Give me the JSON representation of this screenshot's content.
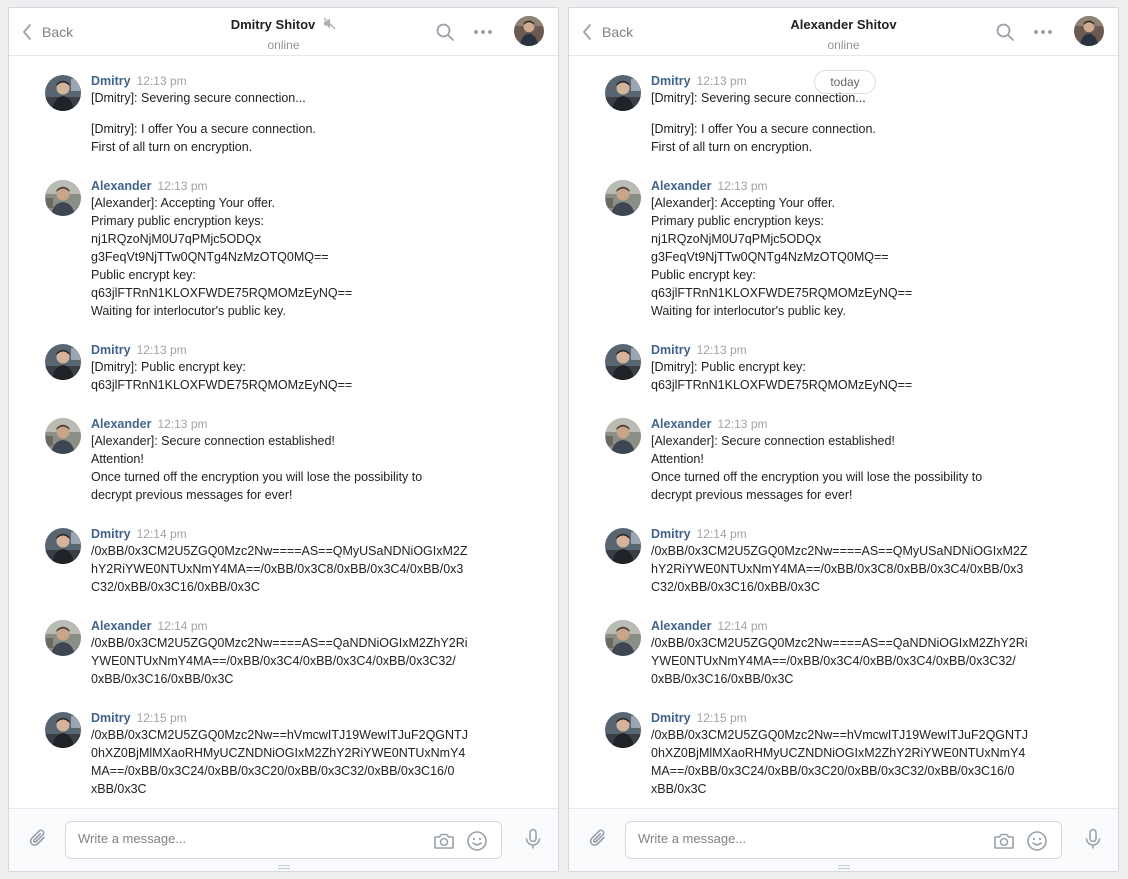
{
  "left_panel": {
    "back_label": "Back",
    "title": "Dmitry Shitov",
    "status": "online",
    "muted": true,
    "date_separator": "",
    "composer_placeholder": "Write a message...",
    "messages": [
      {
        "author": "Dmitry",
        "time": "12:13 pm",
        "paras": [
          [
            "[Dmitry]: Severing secure connection..."
          ],
          [
            "[Dmitry]: I offer You a secure connection.",
            "First of all turn on encryption."
          ]
        ]
      },
      {
        "author": "Alexander",
        "time": "12:13 pm",
        "paras": [
          [
            "[Alexander]: Accepting Your offer.",
            "Primary public encryption keys:",
            "nj1RQzoNjM0U7qPMjc5ODQx",
            "g3FeqVt9NjTTw0QNTg4NzMzOTQ0MQ==",
            "Public encrypt key:",
            "q63jlFTRnN1KLOXFWDE75RQMOMzEyNQ==",
            "Waiting for interlocutor's public key."
          ]
        ]
      },
      {
        "author": "Dmitry",
        "time": "12:13 pm",
        "paras": [
          [
            "[Dmitry]: Public encrypt key:",
            "q63jlFTRnN1KLOXFWDE75RQMOMzEyNQ=="
          ]
        ]
      },
      {
        "author": "Alexander",
        "time": "12:13 pm",
        "paras": [
          [
            "[Alexander]: Secure connection established!",
            "Attention!",
            "Once turned off the encryption you will lose the possibility to",
            "decrypt previous messages for ever!"
          ]
        ]
      },
      {
        "author": "Dmitry",
        "time": "12:14 pm",
        "paras": [
          [
            "/0xBB/0x3CM2U5ZGQ0Mzc2Nw====AS==QMyUSaNDNiOGIxM2Z",
            "hY2RiYWE0NTUxNmY4MA==/0xBB/0x3C8/0xBB/0x3C4/0xBB/0x3",
            "C32/0xBB/0x3C16/0xBB/0x3C"
          ]
        ]
      },
      {
        "author": "Alexander",
        "time": "12:14 pm",
        "paras": [
          [
            "/0xBB/0x3CM2U5ZGQ0Mzc2Nw====AS==QaNDNiOGIxM2ZhY2Ri",
            "YWE0NTUxNmY4MA==/0xBB/0x3C4/0xBB/0x3C4/0xBB/0x3C32/",
            "0xBB/0x3C16/0xBB/0x3C"
          ]
        ]
      },
      {
        "author": "Dmitry",
        "time": "12:15 pm",
        "paras": [
          [
            "/0xBB/0x3CM2U5ZGQ0Mzc2Nw==hVmcwITJ19WewITJuF2QGNTJ",
            "0hXZ0BjMlMXaoRHMyUCZNDNiOGIxM2ZhY2RiYWE0NTUxNmY4",
            "MA==/0xBB/0x3C24/0xBB/0x3C20/0xBB/0x3C32/0xBB/0x3C16/0",
            "xBB/0x3C"
          ]
        ]
      }
    ]
  },
  "right_panel": {
    "back_label": "Back",
    "title": "Alexander Shitov",
    "status": "online",
    "muted": false,
    "date_separator": "today",
    "composer_placeholder": "Write a message...",
    "messages": [
      {
        "author": "Dmitry",
        "time": "12:13 pm",
        "paras": [
          [
            "[Dmitry]: Severing secure connection..."
          ],
          [
            "[Dmitry]: I offer You a secure connection.",
            "First of all turn on encryption."
          ]
        ]
      },
      {
        "author": "Alexander",
        "time": "12:13 pm",
        "paras": [
          [
            "[Alexander]: Accepting Your offer.",
            "Primary public encryption keys:",
            "nj1RQzoNjM0U7qPMjc5ODQx",
            "g3FeqVt9NjTTw0QNTg4NzMzOTQ0MQ==",
            "Public encrypt key:",
            "q63jlFTRnN1KLOXFWDE75RQMOMzEyNQ==",
            "Waiting for interlocutor's public key."
          ]
        ]
      },
      {
        "author": "Dmitry",
        "time": "12:13 pm",
        "paras": [
          [
            "[Dmitry]: Public encrypt key:",
            "q63jlFTRnN1KLOXFWDE75RQMOMzEyNQ=="
          ]
        ]
      },
      {
        "author": "Alexander",
        "time": "12:13 pm",
        "paras": [
          [
            "[Alexander]: Secure connection established!",
            "Attention!",
            "Once turned off the encryption you will lose the possibility to",
            "decrypt previous messages for ever!"
          ]
        ]
      },
      {
        "author": "Dmitry",
        "time": "12:14 pm",
        "paras": [
          [
            "/0xBB/0x3CM2U5ZGQ0Mzc2Nw====AS==QMyUSaNDNiOGIxM2Z",
            "hY2RiYWE0NTUxNmY4MA==/0xBB/0x3C8/0xBB/0x3C4/0xBB/0x3",
            "C32/0xBB/0x3C16/0xBB/0x3C"
          ]
        ]
      },
      {
        "author": "Alexander",
        "time": "12:14 pm",
        "paras": [
          [
            "/0xBB/0x3CM2U5ZGQ0Mzc2Nw====AS==QaNDNiOGIxM2ZhY2Ri",
            "YWE0NTUxNmY4MA==/0xBB/0x3C4/0xBB/0x3C4/0xBB/0x3C32/",
            "0xBB/0x3C16/0xBB/0x3C"
          ]
        ]
      },
      {
        "author": "Dmitry",
        "time": "12:15 pm",
        "paras": [
          [
            "/0xBB/0x3CM2U5ZGQ0Mzc2Nw==hVmcwITJ19WewITJuF2QGNTJ",
            "0hXZ0BjMlMXaoRHMyUCZNDNiOGIxM2ZhY2RiYWE0NTUxNmY4",
            "MA==/0xBB/0x3C24/0xBB/0x3C20/0xBB/0x3C32/0xBB/0x3C16/0",
            "xBB/0x3C"
          ]
        ]
      }
    ]
  },
  "icons": {
    "back": "chevron-left-icon",
    "mute": "speaker-muted-icon",
    "search": "search-icon",
    "more": "more-dots-icon",
    "attach": "paperclip-icon",
    "camera": "camera-icon",
    "emoji": "smile-icon",
    "mic": "microphone-icon"
  },
  "colors": {
    "author_link": "#42648b",
    "timestamp": "#a0a3a6",
    "background": "#edeef0",
    "icon": "#99a2ad"
  }
}
